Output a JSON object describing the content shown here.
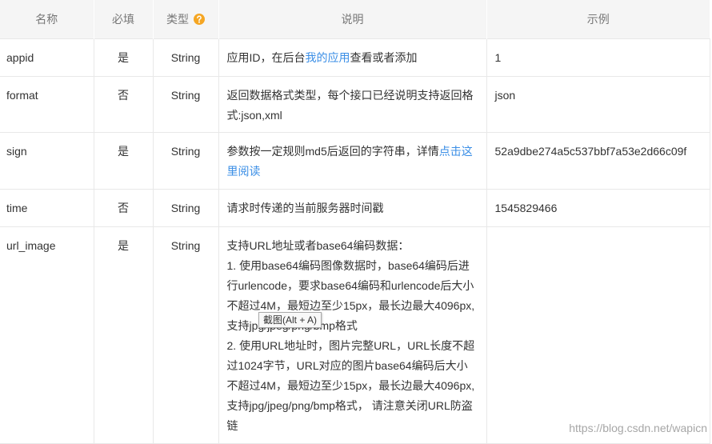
{
  "header": {
    "columns": [
      "名称",
      "必填",
      "类型",
      "说明",
      "示例"
    ],
    "type_help_icon": "question-circle-icon"
  },
  "rows": [
    {
      "name": "appid",
      "required": "是",
      "type": "String",
      "description": {
        "before": "应用ID，在后台",
        "link": "我的应用",
        "after": "查看或者添加"
      },
      "example": "1"
    },
    {
      "name": "format",
      "required": "否",
      "type": "String",
      "description": {
        "text": "返回数据格式类型，每个接口已经说明支持返回格式:json,xml"
      },
      "example": "json"
    },
    {
      "name": "sign",
      "required": "是",
      "type": "String",
      "description": {
        "before": "参数按一定规则md5后返回的字符串，详情",
        "link": "点击这里阅读"
      },
      "example": "52a9dbe274a5c537bbf7a53e2d66c09f"
    },
    {
      "name": "time",
      "required": "否",
      "type": "String",
      "description": {
        "text": "请求时传递的当前服务器时间戳"
      },
      "example": "1545829466"
    },
    {
      "name": "url_image",
      "required": "是",
      "type": "String",
      "description": {
        "paragraphs": [
          "支持URL地址或者base64编码数据：",
          "1. 使用base64编码图像数据时，base64编码后进行urlencode，要求base64编码和urlencode后大小不超过4M，最短边至少15px，最长边最大4096px,支持jpg/jpeg/png/bmp格式",
          "2. 使用URL地址时，图片完整URL，URL长度不超过1024字节，URL对应的图片base64编码后大小不超过4M，最短边至少15px，最长边最大4096px,支持jpg/jpeg/png/bmp格式， 请注意关闭URL防盗链"
        ]
      }
    }
  ],
  "tooltip": {
    "text": "截图(Alt + A)"
  },
  "watermark": "https://blog.csdn.net/wapicn",
  "colors": {
    "header_bg": "#f5f5f5",
    "header_text": "#777777",
    "body_text": "#333333",
    "border": "#e8e8e8",
    "link": "#3a8ee6",
    "help_icon": "#f5a623"
  }
}
